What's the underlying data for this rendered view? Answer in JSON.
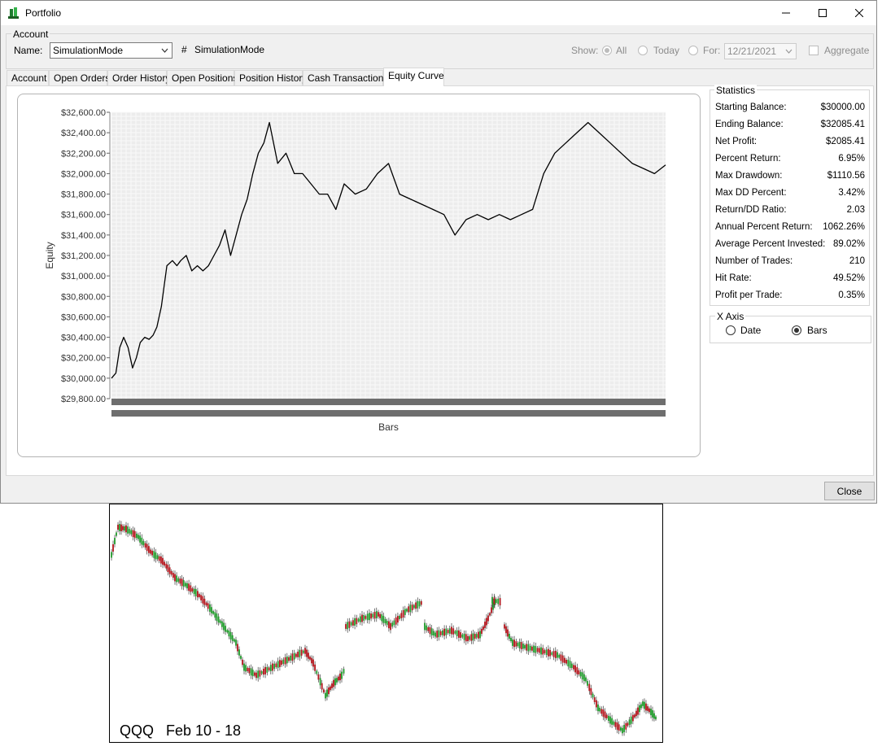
{
  "window": {
    "title": "Portfolio",
    "icon": "green-dollar-icon"
  },
  "account": {
    "group_label": "Account",
    "name_label": "Name:",
    "name_value": "SimulationMode",
    "hash_symbol": "#",
    "account_id": "SimulationMode",
    "show_label": "Show:",
    "show_all": "All",
    "show_today": "Today",
    "show_for": "For:",
    "date_value": "12/21/2021",
    "aggregate_label": "Aggregate",
    "selected_show": "All"
  },
  "tabs": [
    {
      "label": "Account"
    },
    {
      "label": "Open Orders"
    },
    {
      "label": "Order History"
    },
    {
      "label": "Open Positions"
    },
    {
      "label": "Position History"
    },
    {
      "label": "Cash Transactions"
    },
    {
      "label": "Equity Curve"
    }
  ],
  "active_tab": "Equity Curve",
  "statistics": {
    "title": "Statistics",
    "rows": [
      {
        "label": "Starting Balance:",
        "value": "$30000.00"
      },
      {
        "label": "Ending Balance:",
        "value": "$32085.41"
      },
      {
        "label": "Net Profit:",
        "value": "$2085.41"
      },
      {
        "label": "Percent Return:",
        "value": "6.95%"
      },
      {
        "label": "Max Drawdown:",
        "value": "$1110.56"
      },
      {
        "label": "Max DD Percent:",
        "value": "3.42%"
      },
      {
        "label": "Return/DD Ratio:",
        "value": "2.03"
      },
      {
        "label": "Annual Percent Return:",
        "value": "1062.26%"
      },
      {
        "label": "Average Percent Invested:",
        "value": "89.02%"
      },
      {
        "label": "Number of Trades:",
        "value": "210"
      },
      {
        "label": "Hit Rate:",
        "value": "49.52%"
      },
      {
        "label": "Profit per Trade:",
        "value": "0.35%"
      }
    ]
  },
  "x_axis_group": {
    "title": "X Axis",
    "date_label": "Date",
    "bars_label": "Bars",
    "selected": "Bars"
  },
  "buttons": {
    "close_label": "Close"
  },
  "chart_data": [
    {
      "type": "line",
      "title": "",
      "xlabel": "Bars",
      "ylabel": "Equity",
      "ylim": [
        29800,
        32600
      ],
      "xlim": [
        0,
        1000
      ],
      "yticks": [
        "$32,600.00",
        "$32,400.00",
        "$32,200.00",
        "$32,000.00",
        "$31,800.00",
        "$31,600.00",
        "$31,400.00",
        "$31,200.00",
        "$31,000.00",
        "$30,800.00",
        "$30,600.00",
        "$30,400.00",
        "$30,200.00",
        "$30,000.00",
        "$29,800.00"
      ],
      "grid": true,
      "series": [
        {
          "color": "#000000",
          "x": [
            0,
            8,
            15,
            22,
            30,
            38,
            45,
            52,
            60,
            68,
            75,
            82,
            90,
            100,
            110,
            118,
            125,
            135,
            145,
            155,
            165,
            175,
            185,
            195,
            205,
            215,
            225,
            235,
            245,
            255,
            265,
            275,
            285,
            300,
            315,
            330,
            345,
            360,
            375,
            390,
            405,
            420,
            440,
            460,
            480,
            500,
            520,
            540,
            560,
            580,
            600,
            620,
            640,
            660,
            680,
            700,
            720,
            740,
            760,
            780,
            800,
            820,
            840,
            860,
            880,
            900,
            920,
            940,
            960,
            980,
            1000
          ],
          "y": [
            30000,
            30050,
            30300,
            30400,
            30300,
            30100,
            30200,
            30350,
            30400,
            30380,
            30420,
            30500,
            30700,
            31100,
            31150,
            31100,
            31150,
            31200,
            31050,
            31100,
            31050,
            31100,
            31200,
            31300,
            31450,
            31200,
            31400,
            31600,
            31750,
            32000,
            32200,
            32300,
            32500,
            32100,
            32200,
            32000,
            32000,
            31900,
            31800,
            31800,
            31650,
            31900,
            31800,
            31850,
            32000,
            32100,
            31800,
            31750,
            31700,
            31650,
            31600,
            31400,
            31550,
            31600,
            31550,
            31600,
            31550,
            31600,
            31650,
            32000,
            32200,
            32300,
            32400,
            32500,
            32400,
            32300,
            32200,
            32100,
            32050,
            32000,
            32085
          ]
        }
      ]
    },
    {
      "type": "candlestick",
      "caption": "QQQ   Feb 10 - 18"
    }
  ]
}
